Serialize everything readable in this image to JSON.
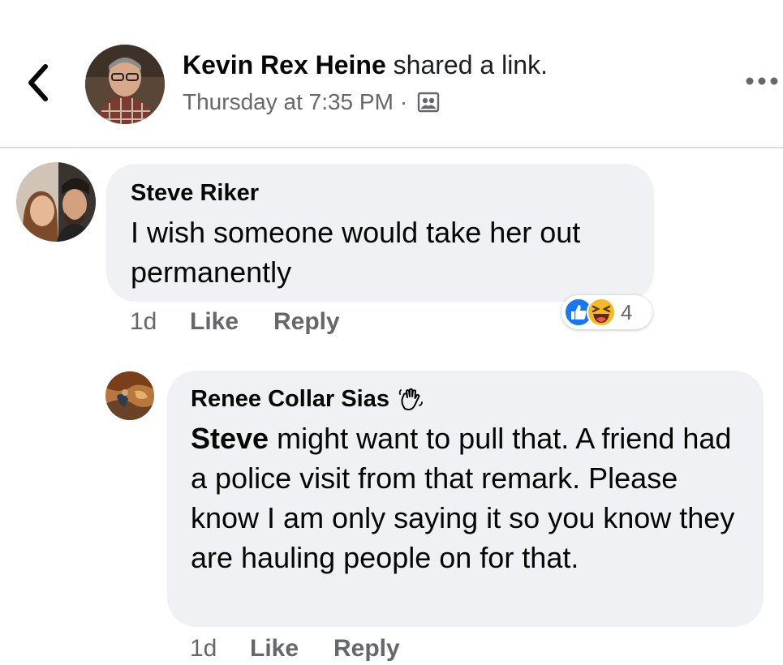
{
  "header": {
    "back_icon": "chevron-left-icon",
    "poster_name": "Kevin Rex Heine",
    "action": "shared a link.",
    "timestamp": "Thursday at 7:35 PM",
    "separator": "·",
    "audience_icon": "friends-audience-icon",
    "more_icon": "more-horizontal-icon"
  },
  "comments": [
    {
      "author": "Steve Riker",
      "text": "I wish someone would take her out permanently",
      "time": "1d",
      "like_label": "Like",
      "reply_label": "Reply",
      "reactions": {
        "icons": [
          "like-reaction-icon",
          "haha-reaction-icon"
        ],
        "count": "4"
      }
    },
    {
      "author": "Renee Collar Sias",
      "badge_icon": "wave-icon",
      "mention": "Steve",
      "text": " might want to pull that. A friend had a police visit from that remark. Please know I am only saying it so you know they are hauling people on for that.",
      "time": "1d",
      "like_label": "Like",
      "reply_label": "Reply"
    }
  ],
  "colors": {
    "bubble": "#eff1f4",
    "muted": "#65676b",
    "like_blue": "#1877f2",
    "haha_yellow": "#f7b928"
  }
}
